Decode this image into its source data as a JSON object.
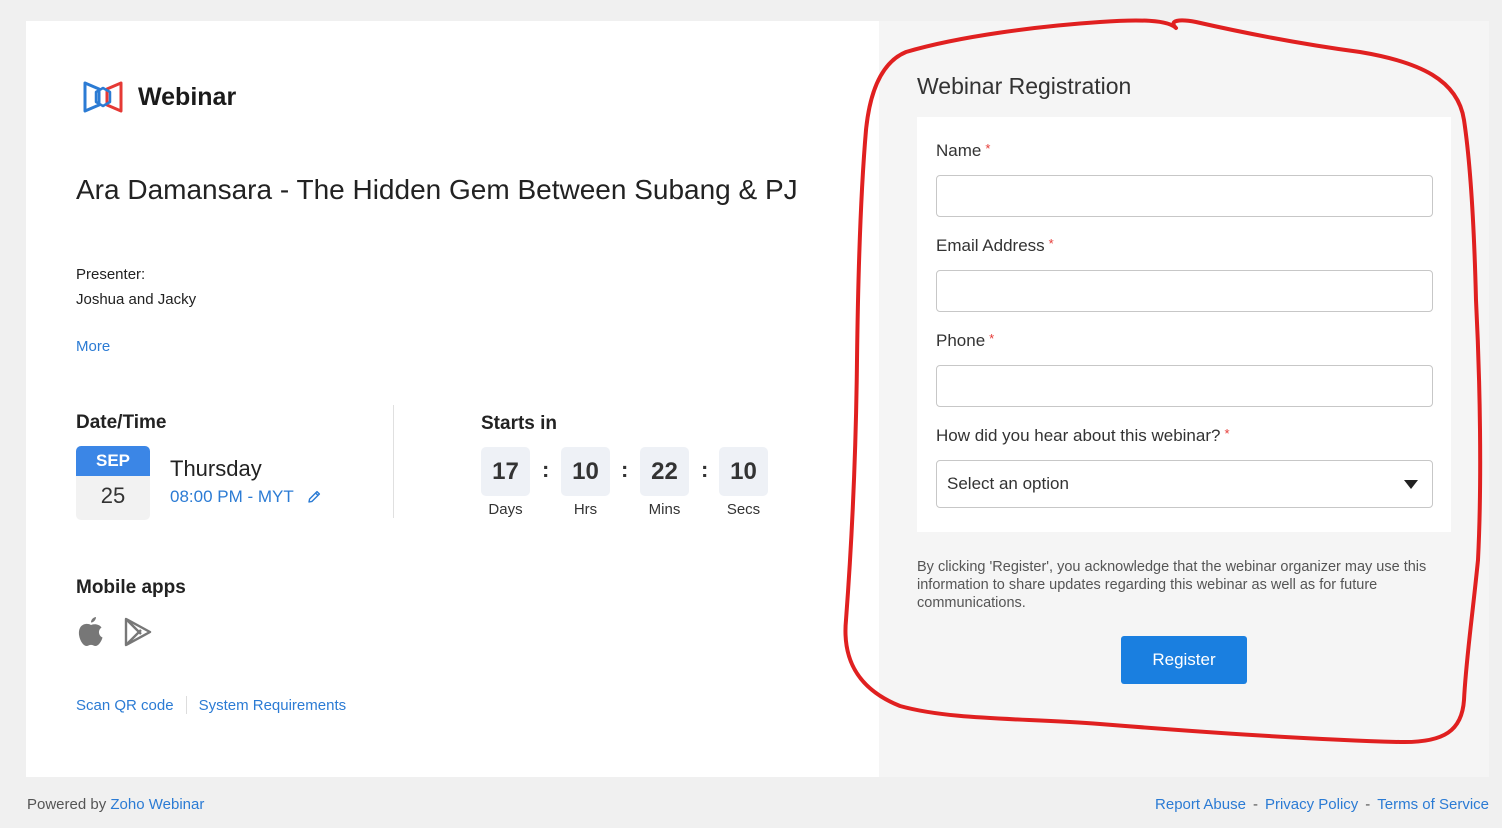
{
  "brand": {
    "name": "Webinar"
  },
  "event": {
    "title": "Ara Damansara - The Hidden Gem Between Subang & PJ",
    "presenter_label": "Presenter:",
    "presenter_name": "Joshua and Jacky",
    "more_label": "More"
  },
  "datetime": {
    "label": "Date/Time",
    "month": "SEP",
    "day": "25",
    "weekday": "Thursday",
    "time": "08:00 PM - MYT"
  },
  "countdown": {
    "label": "Starts in",
    "units": [
      {
        "value": "17",
        "label": "Days"
      },
      {
        "value": "10",
        "label": "Hrs"
      },
      {
        "value": "22",
        "label": "Mins"
      },
      {
        "value": "10",
        "label": "Secs"
      }
    ],
    "separator": ":"
  },
  "mobile": {
    "label": "Mobile apps"
  },
  "links": {
    "scan_qr": "Scan QR code",
    "system_req": "System Requirements"
  },
  "form": {
    "title": "Webinar Registration",
    "required_mark": "*",
    "name_label": "Name",
    "email_label": "Email Address",
    "phone_label": "Phone",
    "source_label": "How did you hear about this webinar?",
    "source_value": "Select an option",
    "name_value": "",
    "email_value": "",
    "phone_value": "",
    "consent": "By clicking 'Register', you acknowledge that the webinar organizer may use this information to share updates regarding this webinar as well as for future communications.",
    "register_label": "Register"
  },
  "footer": {
    "powered_by": "Powered by",
    "powered_link": "Zoho Webinar",
    "report_abuse": "Report Abuse",
    "privacy": "Privacy Policy",
    "terms": "Terms of Service",
    "dash": "-"
  },
  "colors": {
    "accent": "#1a7fe0",
    "link": "#2b7bd4",
    "required": "#e53935",
    "annotation": "#e02020"
  }
}
